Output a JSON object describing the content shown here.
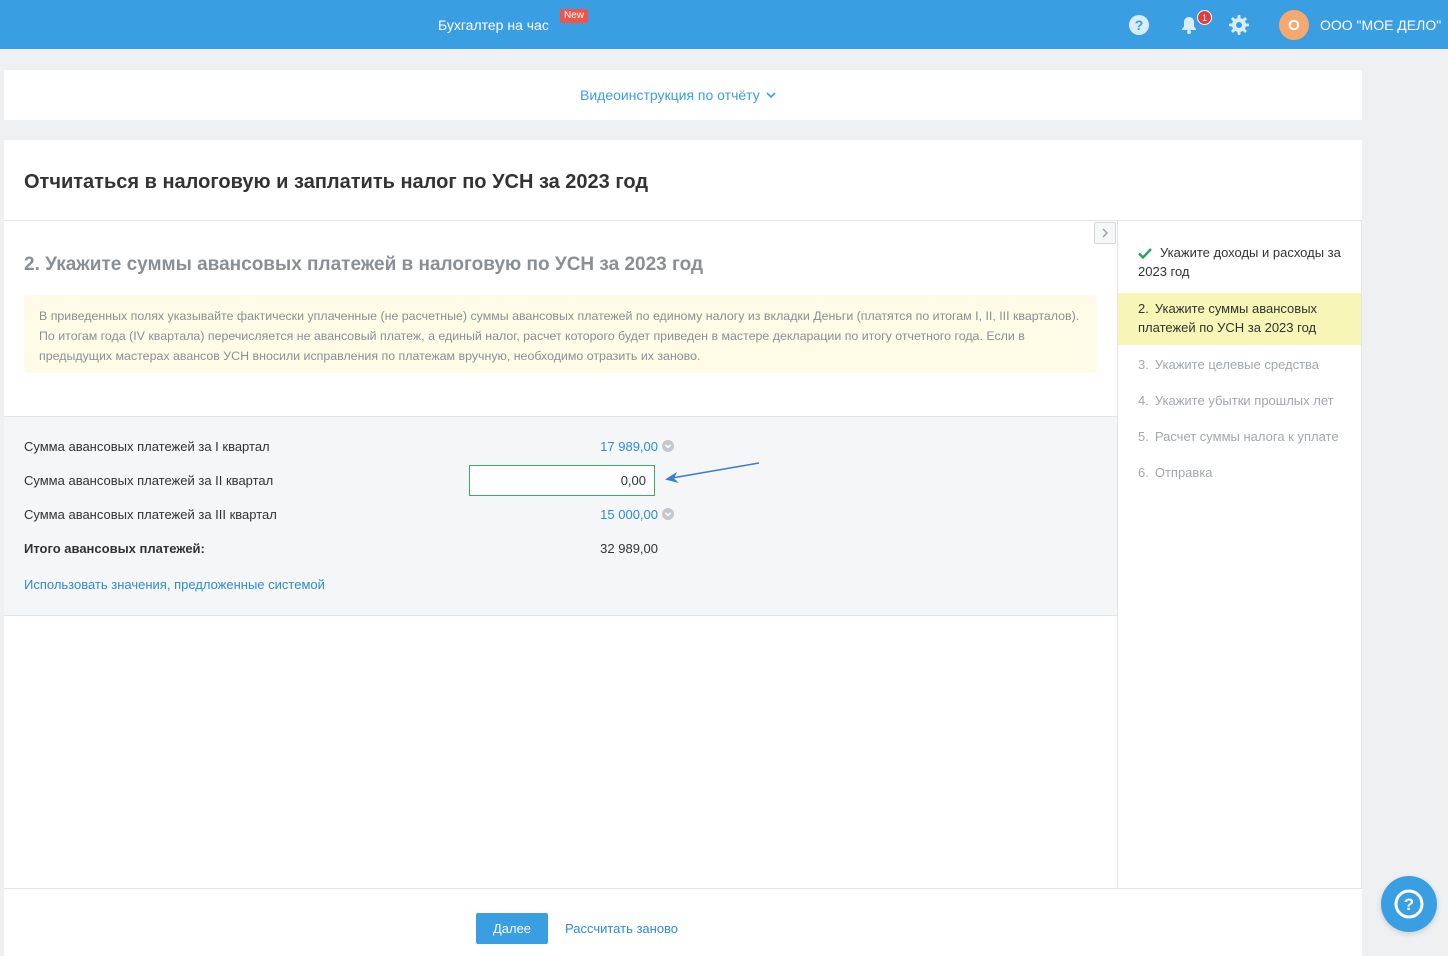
{
  "colors": {
    "brand": "#3a9ee2",
    "link": "#2f8bd0",
    "active_step_bg": "#f7f6b7",
    "info_bg": "#fefce6",
    "input_border": "#3dab69",
    "new_badge": "#f2544b",
    "avatar": "#f5a86f"
  },
  "header": {
    "service_label": "Бухгалтер на час",
    "new_badge": "New",
    "notifications_count": "1",
    "avatar_letter": "О",
    "company_name": "ООО \"МОЕ ДЕЛО\"",
    "icons": [
      "help-circle-icon",
      "bell-icon",
      "gear-icon"
    ]
  },
  "video": {
    "link_label": "Видеоинструкция по отчёту"
  },
  "page": {
    "title": "Отчитаться в налоговую и заплатить налог по УСН за 2023 год",
    "step_heading": "2. Укажите суммы авансовых платежей в налоговую по УСН за 2023 год",
    "info_text": "В приведенных полях указывайте фактически уплаченные (не расчетные) суммы авансовых платежей по единому налогу из вкладки Деньги (платятся по итогам I, II, III кварталов). По итогам года (IV квартала) перечисляется не авансовый платеж, а единый налог, расчет которого будет приведен в мастере декларации по итогу отчетного года. Если в предыдущих мастерах авансов УСН вносили исправления по платежам вручную, необходимо отразить их заново."
  },
  "form": {
    "q1_label": "Сумма авансовых платежей за I квартал",
    "q1_value": "17 989,00",
    "q2_label": "Сумма авансовых платежей за II квартал",
    "q2_value": "0,00",
    "q3_label": "Сумма авансовых платежей за III квартал",
    "q3_value": "15 000,00",
    "total_label": "Итого авансовых платежей:",
    "total_value": "32 989,00",
    "suggest_link": "Использовать значения, предложенные системой"
  },
  "steps": {
    "items": [
      {
        "num": "",
        "label": "Укажите доходы и расходы за 2023 год",
        "state": "done"
      },
      {
        "num": "2.",
        "label": "Укажите суммы авансовых платежей по УСН за 2023 год",
        "state": "active"
      },
      {
        "num": "3.",
        "label": "Укажите целевые средства",
        "state": "pending"
      },
      {
        "num": "4.",
        "label": "Укажите убытки прошлых лет",
        "state": "pending"
      },
      {
        "num": "5.",
        "label": "Расчет суммы налога к уплате",
        "state": "pending"
      },
      {
        "num": "6.",
        "label": "Отправка",
        "state": "pending"
      }
    ]
  },
  "actions": {
    "next_label": "Далее",
    "recalc_label": "Рассчитать заново"
  }
}
